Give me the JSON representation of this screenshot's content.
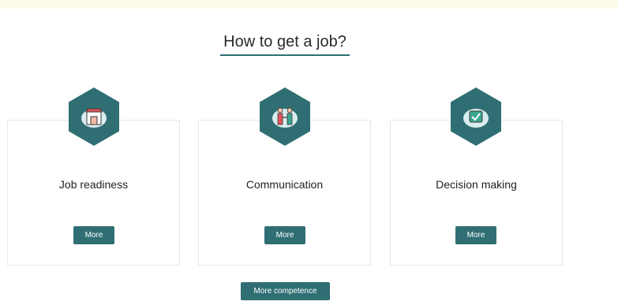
{
  "heading": {
    "title": "How to get a job?"
  },
  "cards": [
    {
      "label": "Job readiness",
      "button_label": "More",
      "icon": "shop-icon"
    },
    {
      "label": "Communication",
      "button_label": "More",
      "icon": "handshake-icon"
    },
    {
      "label": "Decision making",
      "button_label": "More",
      "icon": "checkbox-icon"
    }
  ],
  "footer": {
    "more_competence_label": "More competence"
  },
  "colors": {
    "accent": "#2f6f74",
    "banner": "#fdfae8",
    "card_border": "#e7e7e7"
  }
}
